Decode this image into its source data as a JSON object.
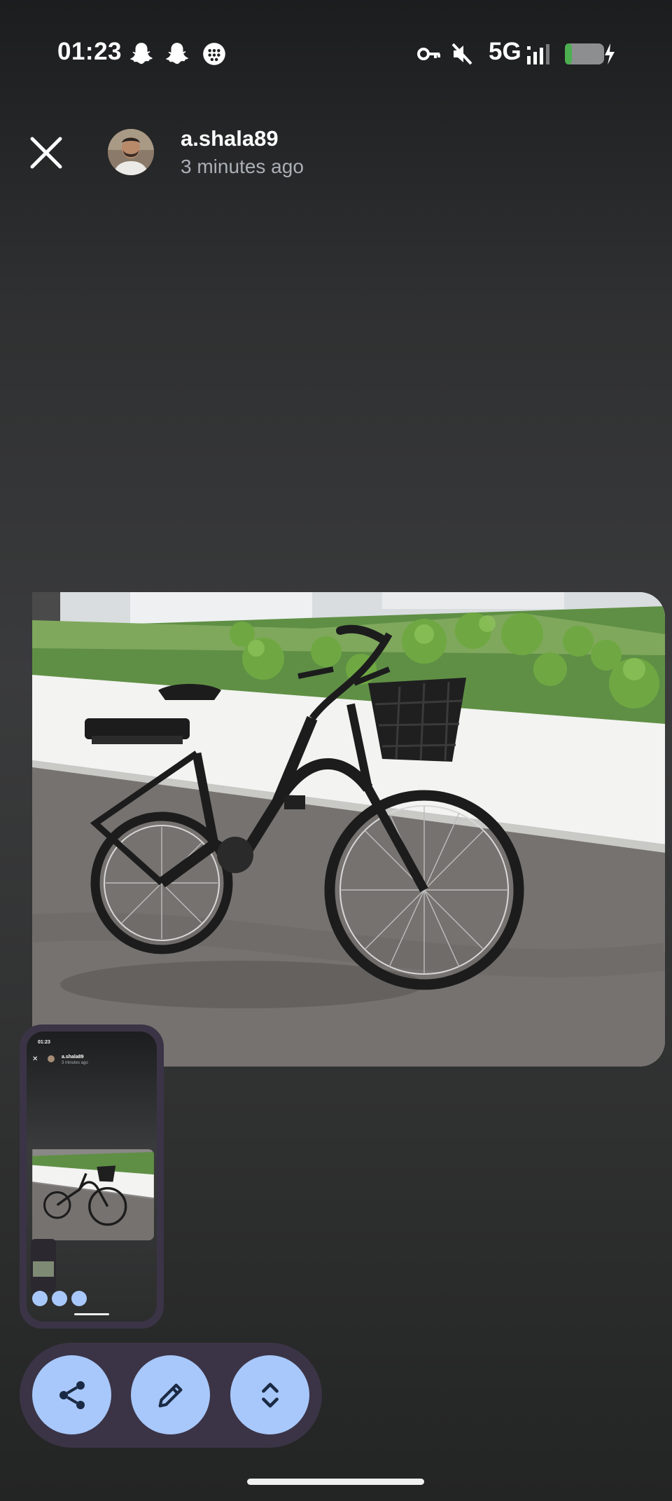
{
  "status_bar": {
    "time": "01:23",
    "network": "5G",
    "notification_icons": [
      "snapchat-ghost-icon",
      "snapchat-ghost-icon",
      "messages-icon"
    ],
    "system_icons": [
      "vpn-key-icon",
      "volume-muted-icon",
      "signal-icon",
      "battery-charging-icon"
    ]
  },
  "header": {
    "close_icon": "close-icon",
    "username": "a.shala89",
    "timestamp": "3 minutes ago"
  },
  "thumbnail": {
    "time": "01:23",
    "username": "a.shala89",
    "timestamp": "3 minutes ago"
  },
  "actions": [
    {
      "name": "share",
      "icon": "share-icon"
    },
    {
      "name": "edit",
      "icon": "pencil-icon"
    },
    {
      "name": "expand",
      "icon": "unfold-icon"
    }
  ],
  "colors": {
    "action_button": "#a8c8fb",
    "action_bar": "#3b3446",
    "battery_charge": "#4caf50"
  }
}
